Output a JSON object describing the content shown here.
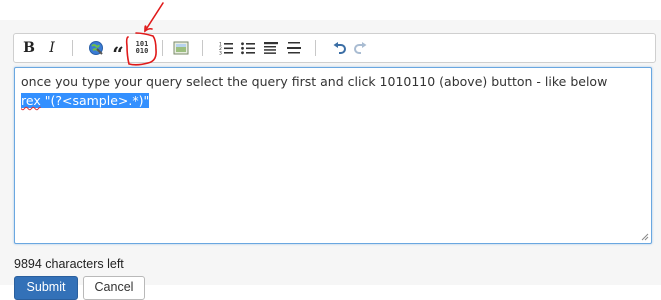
{
  "toolbar": {
    "bold_glyph": "B",
    "italic_glyph": "I",
    "quote_glyph": "“",
    "code_glyph_line1": "101",
    "code_glyph_line2": "010",
    "icons": [
      "bold-icon",
      "italic-icon",
      "link-icon",
      "quote-icon",
      "code-sample-icon",
      "image-icon",
      "numbered-list-icon",
      "bulleted-list-icon",
      "heading-icon",
      "horizontal-rule-icon",
      "undo-icon",
      "redo-icon"
    ],
    "accent_color": "#3b6ea5",
    "annotation_color": "#e01a1a"
  },
  "editor": {
    "line1": "once you type your query select the query first and click 1010110 (above) button - like below",
    "line2_word": "rex",
    "line2_rest": " \"(?<sample>.*)\"",
    "selection_color": "#3390ff",
    "border_color": "#6aa7e0"
  },
  "footer": {
    "chars_left": "9894 characters left",
    "submit_label": "Submit",
    "cancel_label": "Cancel",
    "submit_color": "#3371b8"
  }
}
